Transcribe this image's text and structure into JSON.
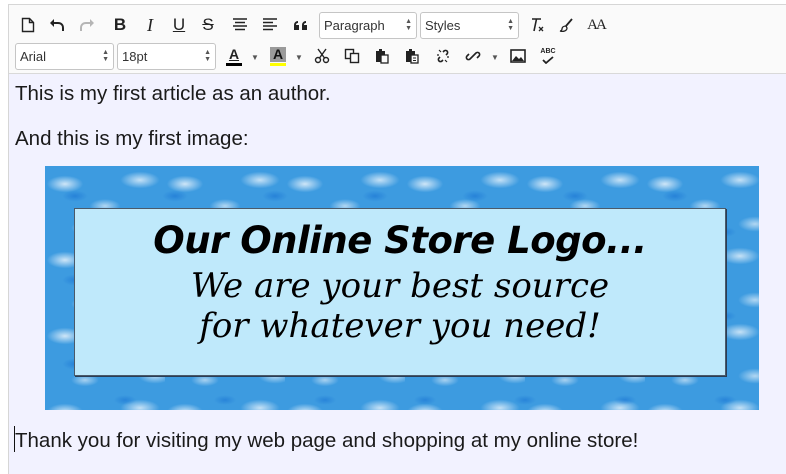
{
  "toolbar": {
    "block_format": "Paragraph",
    "styles": "Styles",
    "font_family": "Arial",
    "font_size": "18pt",
    "bold_label": "B",
    "italic_label": "I",
    "underline_label": "U",
    "strike_label": "S",
    "text_color_label": "A",
    "bg_color_label": "A",
    "font_size_icon_label": "AA",
    "spellcheck_label": "ABC",
    "text_color": "#000000",
    "highlight_color": "#ffff00"
  },
  "content": {
    "paragraph1": "This is my first article as an author.",
    "paragraph2": "And this is my first image:",
    "paragraph3": "Thank you for visiting my web page and shopping at my online store!"
  },
  "image": {
    "line1": "Our Online Store Logo...",
    "line2": "We are your best source",
    "line3": "for whatever you need!"
  }
}
